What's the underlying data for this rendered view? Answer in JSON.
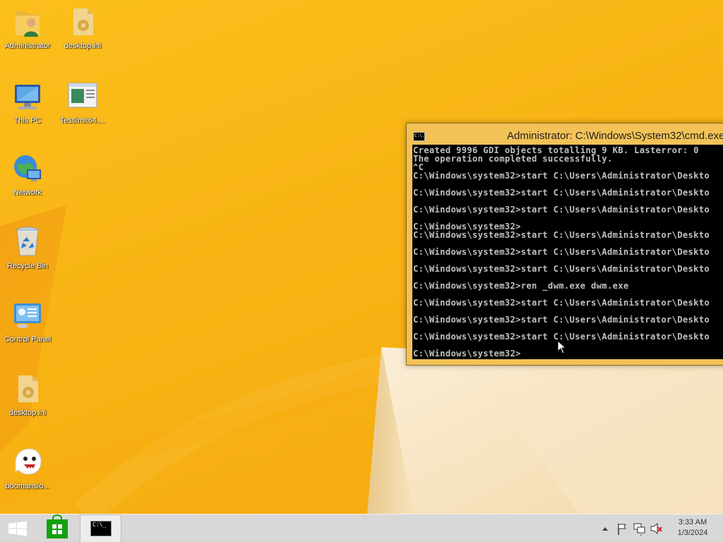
{
  "desktop": {
    "icons": [
      {
        "label": "Administrator",
        "icon": "user-folder-icon"
      },
      {
        "label": "desktop.ini",
        "icon": "settings-file-icon"
      },
      {
        "label": "This PC",
        "icon": "computer-icon"
      },
      {
        "label": "Testlimit64....",
        "icon": "application-window-icon"
      },
      {
        "label": "Network",
        "icon": "network-globe-icon"
      },
      {
        "label": "Recycle Bin",
        "icon": "recycle-bin-icon"
      },
      {
        "label": "Control Panel",
        "icon": "control-panel-icon"
      },
      {
        "label": "desktop.ini",
        "icon": "settings-file-icon"
      },
      {
        "label": "boomansio...",
        "icon": "ghost-icon"
      }
    ]
  },
  "cmd_window": {
    "title": "Administrator: C:\\Windows\\System32\\cmd.exe",
    "icon_text": "C:\\.",
    "console_lines": [
      "Created 9996 GDI objects totalling 9 KB. Lasterror: 0",
      "The operation completed successfully.",
      "^C",
      "C:\\Windows\\system32>start C:\\Users\\Administrator\\Deskto",
      "",
      "C:\\Windows\\system32>start C:\\Users\\Administrator\\Deskto",
      "",
      "C:\\Windows\\system32>start C:\\Users\\Administrator\\Deskto",
      "",
      "C:\\Windows\\system32>",
      "C:\\Windows\\system32>start C:\\Users\\Administrator\\Deskto",
      "",
      "C:\\Windows\\system32>start C:\\Users\\Administrator\\Deskto",
      "",
      "C:\\Windows\\system32>start C:\\Users\\Administrator\\Deskto",
      "",
      "C:\\Windows\\system32>ren _dwm.exe dwm.exe",
      "",
      "C:\\Windows\\system32>start C:\\Users\\Administrator\\Deskto",
      "",
      "C:\\Windows\\system32>start C:\\Users\\Administrator\\Deskto",
      "",
      "C:\\Windows\\system32>start C:\\Users\\Administrator\\Deskto",
      "",
      "C:\\Windows\\system32>"
    ]
  },
  "taskbar": {
    "start_icon": "windows-logo-icon",
    "store_icon": "store-icon",
    "cmd_task_text": "C:\\_",
    "tray_icons": [
      "chevron-up-icon",
      "flag-icon",
      "network-icon",
      "volume-muted-icon"
    ],
    "clock_time": "3:33 AM",
    "clock_date": "1/3/2024"
  },
  "colors": {
    "wallpaper": "#f7b312",
    "console_bg": "#000000",
    "console_text": "#c0c0c0",
    "taskbar": "#d8d8d8"
  }
}
